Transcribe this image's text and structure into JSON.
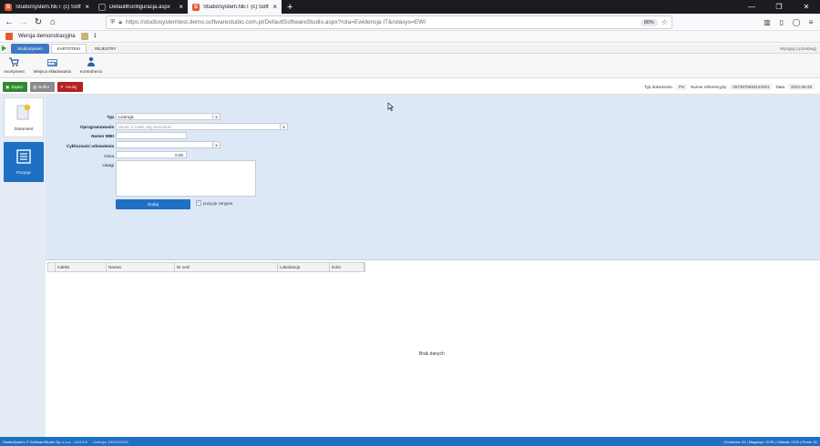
{
  "browser": {
    "tabs": [
      {
        "title": "StudioSystem.NET (c) Software",
        "active": false
      },
      {
        "title": "DefaultKonfiguracja.aspx",
        "active": false
      },
      {
        "title": "StudioSystem.NET (c) Software",
        "active": true
      }
    ],
    "url": "https://studiosystemtest.demo.softwarestudio.com.pl/DefaultSoftwareStudio.aspx?rola=Ewidencja IT&rolasys=EWI",
    "zoom": "80%",
    "bookmark_1": "Wersja demonstracyjna",
    "bookmark_2": "1"
  },
  "app": {
    "tabs": [
      "StudioSystem",
      "KARTOTEKI",
      "REJESTRY"
    ],
    "logout": "Wyloguj (r.przebieg)",
    "ribbon": [
      {
        "label": "Asortyment",
        "icon": "cart-icon"
      },
      {
        "label": "Miejsca składowania",
        "icon": "warehouse-icon"
      },
      {
        "label": "Kontrahenci",
        "icon": "people-icon"
      }
    ],
    "actions": {
      "save": "Zapisz",
      "cancel_doc": "Buffor",
      "cancel": "Anuluj"
    },
    "docinfo": {
      "type_label": "Typ dokumentu",
      "type_value": "PH",
      "ref_label": "Numer referencyjny",
      "ref_value": "0572875693140301",
      "date_label": "Data",
      "date_value": "2022-06-28"
    },
    "side": {
      "document": "Dokument",
      "positions": "Pozycje"
    },
    "form": {
      "typ_label": "Typ",
      "typ_value": "Licencja",
      "oprog_label": "Oprogramowanie",
      "oprog_placeholder": "Wpisz 3 znaki, aby wyszukać",
      "imei_label": "Numer IMEI",
      "cykl_label": "Cykliczność odnowienia",
      "cena_label": "Cena",
      "cena_value": "0.00",
      "uwagi_label": "Uwagi",
      "add_button": "Dodaj",
      "checkbox_label": "pozycje zerypne"
    },
    "grid": {
      "columns": [
        "Indeks",
        "Nazwa",
        "Nr serii",
        "Lokalizacja",
        "Ilości"
      ],
      "empty": "Brak danych"
    },
    "status": {
      "left": "StudioSystem © SoftwareStudio Sp. z o.o. - v3.0.0.0",
      "license": "Licencja: DEMO/2408",
      "right": "| Komórka: 02 | Magazyn: GOR | Oddział: CEN | Firma: 01"
    }
  }
}
